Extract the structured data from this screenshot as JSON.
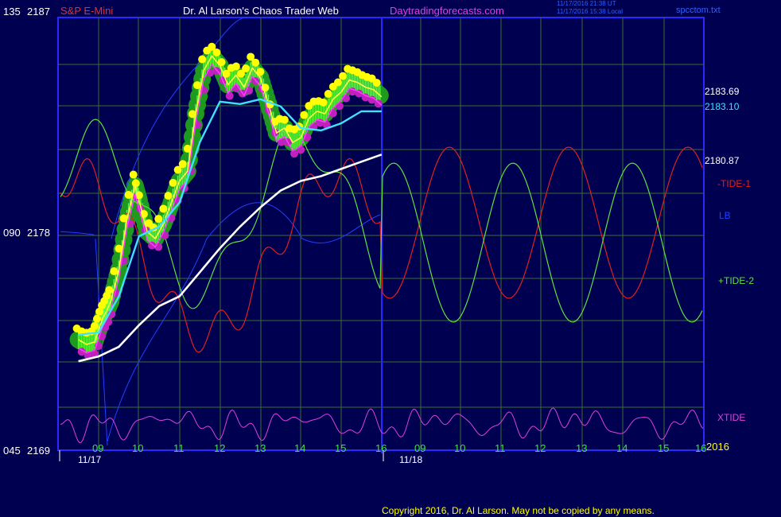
{
  "header": {
    "instrument": "S&P E-Mini",
    "site": "Dr. Al Larson's Chaos Trader Web",
    "url": "Daytradingforecasts.com",
    "timestamp_utc": "11/17/2016 21:38 UT",
    "timestamp_local": "11/17/2016 15:38 Local",
    "filename": "spcctom.txt"
  },
  "footer": {
    "copyright": "Copyright 2016, Dr. Al Larson. May not be copied by any means."
  },
  "colors": {
    "background": "#000050",
    "plot_border": "#2a2aff",
    "grid": "#3b6e2f",
    "price_ma_fast": "#40e0ff",
    "price_ma_slow": "#ffffff",
    "tide1": "#e02020",
    "tide2": "#60e040",
    "lb": "#2040ff",
    "xtide": "#e040e0",
    "price_text": "#ffff00"
  },
  "chart_data": {
    "type": "line",
    "title": "S&P E-Mini",
    "y_axis_left_labels": [
      {
        "code": "135",
        "price": "2187"
      },
      {
        "code": "090",
        "price": "2178"
      },
      {
        "code": "045",
        "price": "2169"
      }
    ],
    "ylim": [
      2169,
      2187
    ],
    "x_tick_labels_day1": [
      "09",
      "10",
      "11",
      "12",
      "13",
      "14",
      "15",
      "16"
    ],
    "x_tick_labels_day2": [
      "09",
      "10",
      "11",
      "12",
      "13",
      "14",
      "15",
      "16"
    ],
    "date_labels": [
      "11/17",
      "11/18"
    ],
    "year_label": "2016",
    "right_price_labels": [
      {
        "text": "2183.69",
        "color": "#ffffff"
      },
      {
        "text": "2183.10",
        "color": "#40e0ff"
      },
      {
        "text": "2180.87",
        "color": "#ffffff"
      }
    ],
    "series_labels": [
      {
        "name": "-TIDE-1",
        "color": "#e02020"
      },
      {
        "name": "LB",
        "color": "#2040ff"
      },
      {
        "name": "+TIDE-2",
        "color": "#60e040"
      },
      {
        "name": "XTIDE",
        "color": "#e040e0"
      }
    ],
    "series": [
      {
        "name": "Price",
        "x_hours": [
          8.5,
          8.7,
          8.9,
          9.0,
          9.1,
          9.2,
          9.3,
          9.5,
          9.7,
          9.9,
          10.0,
          10.2,
          10.4,
          10.6,
          10.8,
          11.0,
          11.2,
          11.4,
          11.6,
          11.8,
          12.0,
          12.2,
          12.4,
          12.6,
          12.8,
          13.0,
          13.2,
          13.4,
          13.6,
          13.8,
          14.0,
          14.2,
          14.4,
          14.6,
          14.8,
          15.0,
          15.2,
          15.4,
          15.6,
          15.8,
          16.0
        ],
        "values": [
          2173.6,
          2173.4,
          2173.5,
          2174.0,
          2174.5,
          2174.8,
          2175.2,
          2176.5,
          2178.6,
          2180.0,
          2179.4,
          2178.1,
          2177.8,
          2178.4,
          2179.3,
          2180.2,
          2180.6,
          2183.0,
          2184.8,
          2185.4,
          2185.0,
          2184.2,
          2184.6,
          2184.1,
          2184.9,
          2184.5,
          2183.4,
          2182.2,
          2182.4,
          2181.8,
          2182.0,
          2182.8,
          2183.1,
          2183.0,
          2183.6,
          2183.9,
          2184.4,
          2184.3,
          2184.1,
          2184.0,
          2183.7
        ]
      },
      {
        "name": "Fast MA",
        "x_hours": [
          8.5,
          9.0,
          9.5,
          10.0,
          10.5,
          11.0,
          11.5,
          12.0,
          12.5,
          13.0,
          13.5,
          14.0,
          14.5,
          15.0,
          15.5,
          16.0
        ],
        "values": [
          2173.8,
          2173.9,
          2175.4,
          2177.9,
          2178.3,
          2179.3,
          2181.8,
          2183.5,
          2183.4,
          2183.6,
          2183.3,
          2182.4,
          2182.3,
          2182.6,
          2183.1,
          2183.1
        ]
      },
      {
        "name": "Slow MA",
        "x_hours": [
          8.5,
          9.0,
          9.5,
          10.0,
          10.5,
          11.0,
          11.5,
          12.0,
          12.5,
          13.0,
          13.5,
          14.0,
          14.5,
          15.0,
          15.5,
          16.0
        ],
        "values": [
          2172.7,
          2172.9,
          2173.3,
          2174.2,
          2175.0,
          2175.4,
          2176.4,
          2177.4,
          2178.3,
          2179.1,
          2179.8,
          2180.2,
          2180.4,
          2180.7,
          2181.0,
          2181.3
        ]
      }
    ],
    "grid": true
  }
}
